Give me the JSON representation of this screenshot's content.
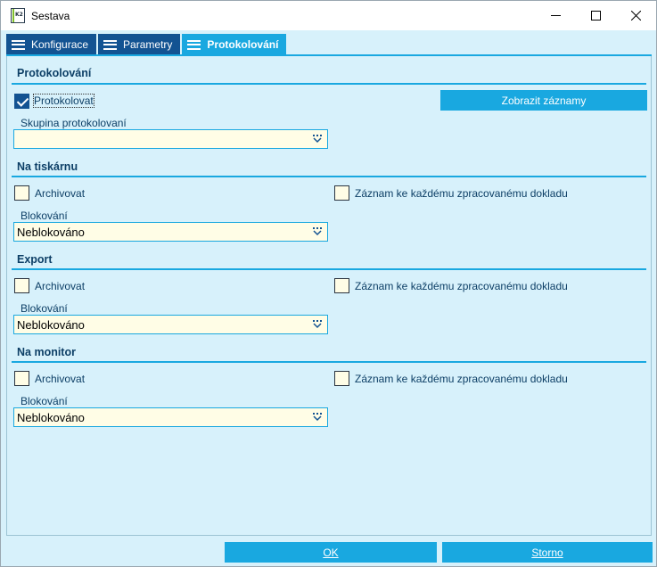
{
  "window": {
    "title": "Sestava",
    "logo_text": "K2"
  },
  "tabs": [
    {
      "label": "Konfigurace",
      "active": false
    },
    {
      "label": "Parametry",
      "active": false
    },
    {
      "label": "Protokolování",
      "active": true
    }
  ],
  "protokolovani": {
    "title": "Protokolování",
    "checkbox_label": "Protokolovat",
    "checked": true,
    "show_button": "Zobrazit záznamy",
    "group_label": "Skupina protokolovaní",
    "group_value": ""
  },
  "sections": [
    {
      "title": "Na tiskárnu",
      "archive_label": "Archivovat",
      "record_label": "Záznam ke každému zpracovanému dokladu",
      "block_label": "Blokování",
      "block_value": "Neblokováno"
    },
    {
      "title": "Export",
      "archive_label": "Archivovat",
      "record_label": "Záznam ke každému zpracovanému dokladu",
      "block_label": "Blokování",
      "block_value": "Neblokováno"
    },
    {
      "title": "Na monitor",
      "archive_label": "Archivovat",
      "record_label": "Záznam ke každému zpracovanému dokladu",
      "block_label": "Blokování",
      "block_value": "Neblokováno"
    }
  ],
  "footer": {
    "ok_label": "OK",
    "cancel_label": "Storno"
  },
  "colors": {
    "accent": "#19a8e0",
    "tab_dark": "#135392",
    "panel_bg": "#d7f1fb",
    "field_bg": "#fffde6"
  }
}
